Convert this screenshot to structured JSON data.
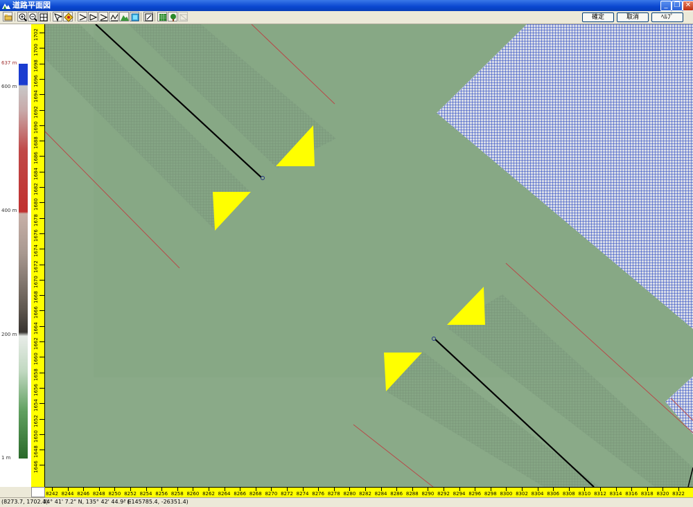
{
  "window": {
    "title": "道路平面図",
    "minimize_icon": "minimize-icon",
    "restore_icon": "restore-icon",
    "close_icon": "close-icon"
  },
  "toolbar": {
    "icons": [
      "open-icon",
      "zoom-in-icon",
      "zoom-out-icon",
      "zoom-fit-icon",
      "pan-icon",
      "target-icon",
      "select-icon",
      "select-area-icon",
      "select-line-icon",
      "measure-icon",
      "terrain-icon",
      "layers-icon",
      "edit-icon",
      "grid-icon",
      "tree-icon",
      "disabled-icon"
    ],
    "ok_label": "確定",
    "cancel_label": "取消",
    "help_label": "ﾍﾙﾌﾟ"
  },
  "legend": {
    "max_label": "637 m",
    "label_600": "600 m",
    "label_400": "400 m",
    "label_200": "200 m",
    "label_1": "1 m"
  },
  "vertical_ruler": {
    "labels": [
      "1702",
      "1700",
      "1698",
      "1696",
      "1694",
      "1692",
      "1690",
      "1688",
      "1686",
      "1684",
      "1682",
      "1680",
      "1678",
      "1676",
      "1674",
      "1672",
      "1670",
      "1668",
      "1666",
      "1664",
      "1662",
      "1660",
      "1658",
      "1656",
      "1654",
      "1652",
      "1650",
      "1648",
      "1646"
    ]
  },
  "horizontal_ruler": {
    "labels": [
      "8242",
      "8244",
      "8246",
      "8248",
      "8250",
      "8252",
      "8254",
      "8256",
      "8258",
      "8260",
      "8262",
      "8264",
      "8266",
      "8268",
      "8270",
      "8272",
      "8274",
      "8276",
      "8278",
      "8280",
      "8282",
      "8284",
      "8286",
      "8288",
      "8290",
      "8292",
      "8294",
      "8296",
      "8298",
      "8300",
      "8302",
      "8304",
      "8306",
      "8308",
      "8310",
      "8312",
      "8314",
      "8316",
      "8318",
      "8320",
      "8322"
    ]
  },
  "status": {
    "coords": "(8273.7, 1702.4)",
    "latlon": "34° 41' 7.2\" N, 135° 42' 44.9\" E",
    "xy": "- (-145785.4, -26351.4)"
  },
  "colors": {
    "terrain": "#8aaa88",
    "water": "#2040c0",
    "marker": "#ffff00",
    "ruler": "#ffff00"
  }
}
